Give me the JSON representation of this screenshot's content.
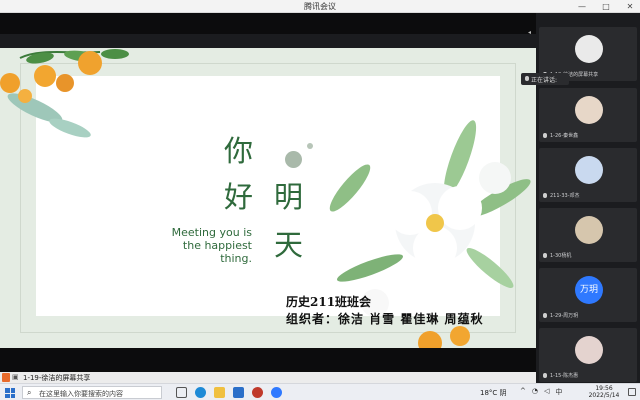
{
  "window": {
    "title": "腾讯会议",
    "min": "—",
    "max": "□",
    "close": "✕"
  },
  "slide": {
    "greeting": [
      "你",
      "好",
      "明",
      "天"
    ],
    "english": "Meeting you is the happiest thing.",
    "class_title": "历史211班班会",
    "organizers": "组织者：徐洁 肖雪 瞿佳琳 周蕴秋"
  },
  "share_bar": {
    "label": "1-19-徐洁的屏幕共享"
  },
  "speaking": {
    "label": "正在讲话:"
  },
  "participants": [
    {
      "name": "1-19-徐洁的屏幕共享",
      "avatar": ""
    },
    {
      "name": "1-26-秦世鑫",
      "avatar": ""
    },
    {
      "name": "211-33-邓杰",
      "avatar": ""
    },
    {
      "name": "1-30杨机",
      "avatar": ""
    },
    {
      "name": "1-29-周万玥",
      "avatar": "万玥"
    },
    {
      "name": "1-15-陈杰惠",
      "avatar": ""
    }
  ],
  "taskbar": {
    "search_placeholder": "在这里输入你要搜索的内容",
    "weather": "18°C 阴",
    "ime": "中",
    "time": "19:56",
    "date": "2022/5/14"
  },
  "colors": {
    "slide_green": "#2f6a3c",
    "accent_blue": "#2f79ff",
    "badge_orange": "#e86a2a"
  }
}
